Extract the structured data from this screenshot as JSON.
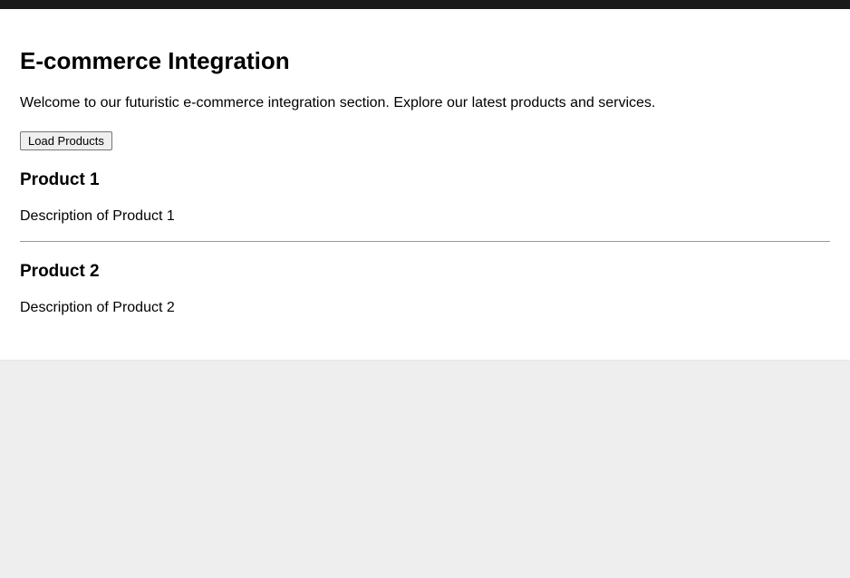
{
  "header": {
    "title": "E-commerce Integration"
  },
  "intro": "Welcome to our futuristic e-commerce integration section. Explore our latest products and services.",
  "buttons": {
    "load": "Load Products"
  },
  "products": [
    {
      "name": "Product 1",
      "description": "Description of Product 1"
    },
    {
      "name": "Product 2",
      "description": "Description of Product 2"
    }
  ]
}
